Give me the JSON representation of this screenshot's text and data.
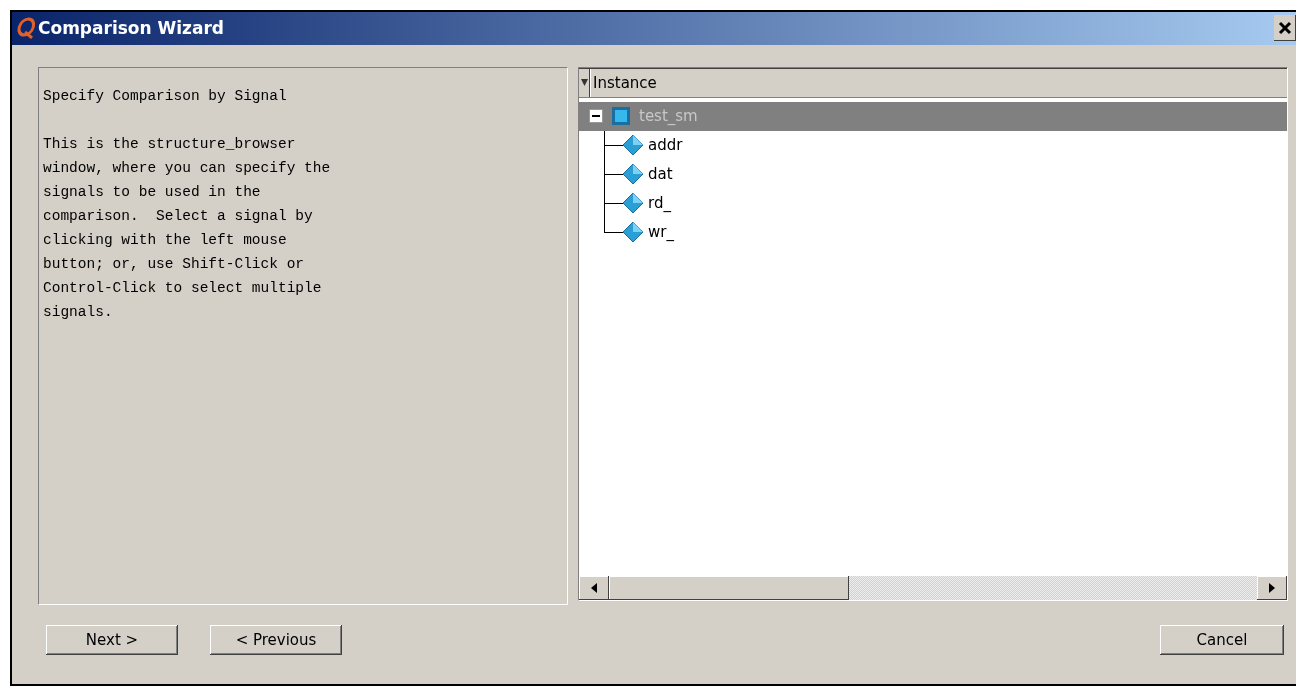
{
  "window": {
    "title": "Comparison Wizard"
  },
  "description": {
    "heading": "Specify Comparison by Signal",
    "body": "This is the structure_browser window, where you can specify the signals to be used in the comparison.  Select a signal by clicking with the left mouse button; or, use Shift-Click or Control-Click to select multiple signals."
  },
  "tree": {
    "column": "Instance",
    "items": [
      {
        "label": "test_sm",
        "expanded": true,
        "selected": true,
        "children": [
          {
            "label": "addr",
            "selected": false
          },
          {
            "label": "dat",
            "selected": false
          },
          {
            "label": "rd_",
            "selected": false
          },
          {
            "label": "wr_",
            "selected": false
          }
        ]
      }
    ]
  },
  "buttons": {
    "left": [
      "Next >",
      "< Previous"
    ],
    "right": [
      "Cancel"
    ]
  }
}
